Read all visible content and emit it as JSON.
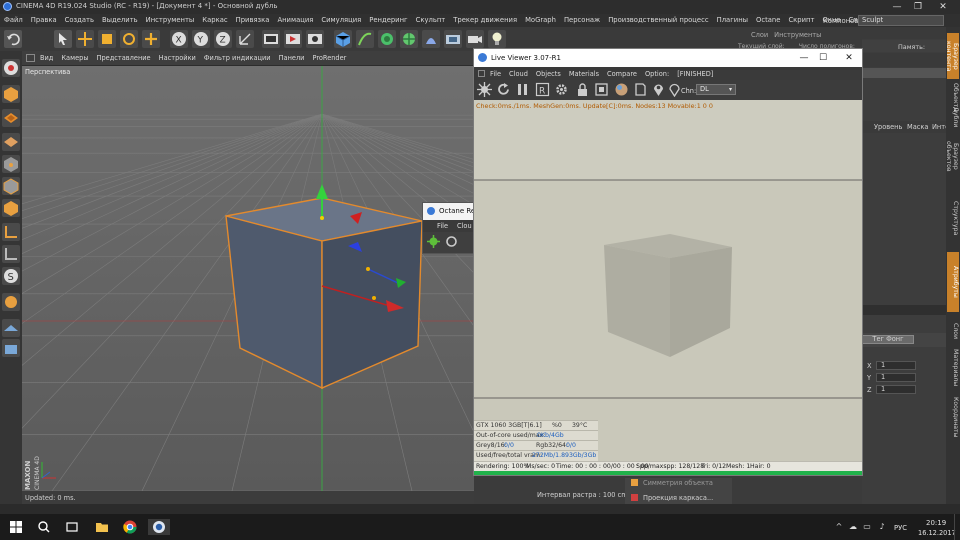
{
  "window": {
    "title": "CINEMA 4D R19.024 Studio (RC - R19) - [Документ 4 *] - Основной дубль",
    "controls": [
      "—",
      "❐",
      "✕"
    ]
  },
  "menubar": {
    "items": [
      "Файл",
      "Правка",
      "Создать",
      "Выделить",
      "Инструменты",
      "Каркас",
      "Привязка",
      "Анимация",
      "Симуляция",
      "Рендеринг",
      "Скульпт",
      "Трекер движения",
      "MoGraph",
      "Персонаж",
      "Производственный процесс",
      "Плагины",
      "Octane",
      "Скрипт",
      "Окно",
      "Справ"
    ],
    "layout_label": "Компоновка:",
    "layout_value": "Sculpt"
  },
  "viewport": {
    "menu": [
      "Вид",
      "Камеры",
      "Представление",
      "Настройки",
      "Фильтр индикации",
      "Панели",
      "ProRender"
    ],
    "label": "Перспектива",
    "updated": "Updated: 0 ms.",
    "watermark_line1": "MAXON",
    "watermark_line2": "CINEMA 4D"
  },
  "raster_scale": "Интервал растра : 100 cm",
  "bottom_right": {
    "item1": "Симметрия объекта",
    "item2": "Проекция каркаса..."
  },
  "right_panel": {
    "tabs_row": [
      "Слои",
      "Инструменты"
    ],
    "row2": [
      "Текущий слой:",
      "Число полигонов:",
      "Память:"
    ],
    "row3": [
      "Уровень",
      "Маска",
      "Инте"
    ],
    "phong_button": "Тег Фонг",
    "xyz": [
      {
        "axis": "X",
        "value": "1"
      },
      {
        "axis": "Y",
        "value": "1"
      },
      {
        "axis": "Z",
        "value": "1"
      }
    ],
    "vertical_tabs": [
      "Браузер контента",
      "Объекты",
      "Дубли",
      "Браузер объектов",
      "Структура",
      "Атрибуты",
      "Слои",
      "Материалы",
      "Координаты"
    ]
  },
  "octane_small": {
    "title": "Octane Re",
    "menu": [
      "File",
      "Clou"
    ]
  },
  "live_viewer": {
    "title": "Live Viewer 3.07-R1",
    "menu": [
      "File",
      "Cloud",
      "Objects",
      "Materials",
      "Compare",
      "Option:",
      "[FINISHED]"
    ],
    "chn_label": "Chn:",
    "chn_value": "DL",
    "check_line": "Check:0ms./1ms. MeshGen:0ms. Update[C]:0ms. Nodes:13 Movable:1  0 0",
    "gpu": {
      "name": "GTX 1060 3GB[T|6.1]",
      "util": "%0",
      "temp": "39°C"
    },
    "out_of_core": {
      "label": "Out-of-core used/max:",
      "value": "0Kb/4Gb"
    },
    "grey": {
      "label": "Grey8/16:",
      "value": "0/0",
      "rgb_label": "Rgb32/64:",
      "rgb_value": "0/0"
    },
    "vram": {
      "label": "Used/free/total vram:",
      "value": "272Mb/1.893Gb/3Gb"
    },
    "status": {
      "rendering": "Rendering: 100%",
      "ms_sec": "Ms/sec: 0",
      "time": "Time: 00 : 00 : 00/00 : 00 : 00",
      "spp": "Spp/maxspp: 128/128",
      "tri": "Tri: 0/12",
      "mesh": "Mesh: 1",
      "hair": "Hair: 0"
    },
    "progress": 1.0
  },
  "taskbar": {
    "lang": "РУС",
    "time": "20:19",
    "date": "16.12.2017"
  },
  "colors": {
    "accent_orange": "#e38a2d",
    "green_progress": "#21b24b",
    "viewport_bg": "#646464"
  }
}
